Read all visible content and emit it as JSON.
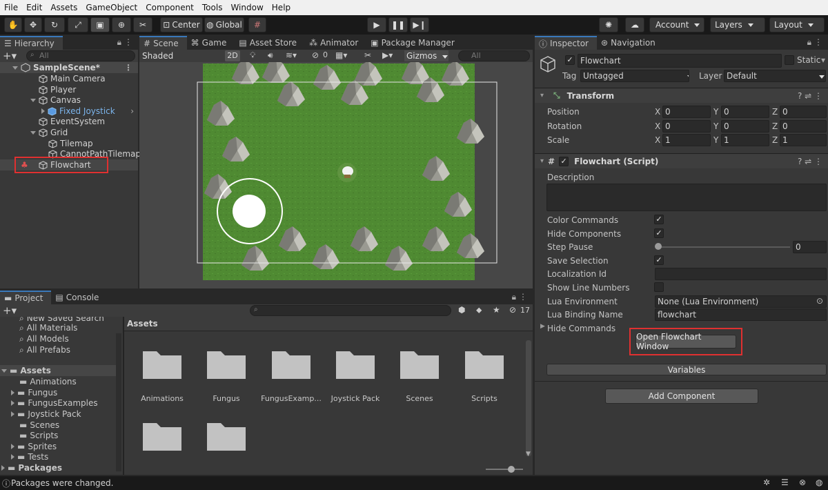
{
  "menu": [
    "File",
    "Edit",
    "Assets",
    "GameObject",
    "Component",
    "Tools",
    "Window",
    "Help"
  ],
  "toolbar": {
    "center_label": "Center",
    "global_label": "Global",
    "account_label": "Account",
    "layers_label": "Layers",
    "layout_label": "Layout"
  },
  "hierarchy": {
    "tab": "Hierarchy",
    "search_placeholder": "All",
    "scene": "SampleScene*",
    "items": [
      {
        "name": "Main Camera"
      },
      {
        "name": "Player"
      },
      {
        "name": "Canvas"
      },
      {
        "name": "Fixed Joystick"
      },
      {
        "name": "EventSystem"
      },
      {
        "name": "Grid"
      },
      {
        "name": "Tilemap"
      },
      {
        "name": "CannotPathTilemap"
      },
      {
        "name": "Flowchart"
      }
    ]
  },
  "scene_view": {
    "tabs": [
      "Scene",
      "Game",
      "Asset Store",
      "Animator",
      "Package Manager"
    ],
    "shading": "Shaded",
    "mode_2d": "2D",
    "hidden_count": "0",
    "gizmos": "Gizmos",
    "search_placeholder": "All"
  },
  "inspector": {
    "tabs": [
      "Inspector",
      "Navigation"
    ],
    "object_name": "Flowchart",
    "static_label": "Static",
    "tag_label": "Tag",
    "tag_value": "Untagged",
    "layer_label": "Layer",
    "layer_value": "Default",
    "transform": {
      "title": "Transform",
      "position_label": "Position",
      "rotation_label": "Rotation",
      "scale_label": "Scale",
      "axis_x": "X",
      "axis_y": "Y",
      "axis_z": "Z",
      "position": [
        "0",
        "0",
        "0"
      ],
      "rotation": [
        "0",
        "0",
        "0"
      ],
      "scale": [
        "1",
        "1",
        "1"
      ]
    },
    "flowchart": {
      "title": "Flowchart (Script)",
      "description_label": "Description",
      "color_commands": "Color Commands",
      "hide_components": "Hide Components",
      "step_pause": "Step Pause",
      "step_pause_value": "0",
      "save_selection": "Save Selection",
      "localization_id": "Localization Id",
      "show_line_numbers": "Show Line Numbers",
      "lua_environment": "Lua Environment",
      "lua_environment_value": "None (Lua Environment)",
      "lua_binding_name": "Lua Binding Name",
      "lua_binding_value": "flowchart",
      "hide_commands": "Hide Commands",
      "open_button": "Open Flowchart Window",
      "variables": "Variables"
    },
    "add_component": "Add Component"
  },
  "project": {
    "tabs": [
      "Project",
      "Console"
    ],
    "hidden_count": "17",
    "favorites": [
      "New Saved Search",
      "All Materials",
      "All Models",
      "All Prefabs"
    ],
    "assets_label": "Assets",
    "tree": [
      "Animations",
      "Fungus",
      "FungusExamples",
      "Joystick Pack",
      "Scenes",
      "Scripts",
      "Sprites",
      "Tests"
    ],
    "packages_label": "Packages",
    "breadcrumb": "Assets",
    "folders": [
      "Animations",
      "Fungus",
      "FungusExamp...",
      "Joystick Pack",
      "Scenes",
      "Scripts",
      "",
      ""
    ]
  },
  "status": {
    "message": "Packages were changed."
  }
}
